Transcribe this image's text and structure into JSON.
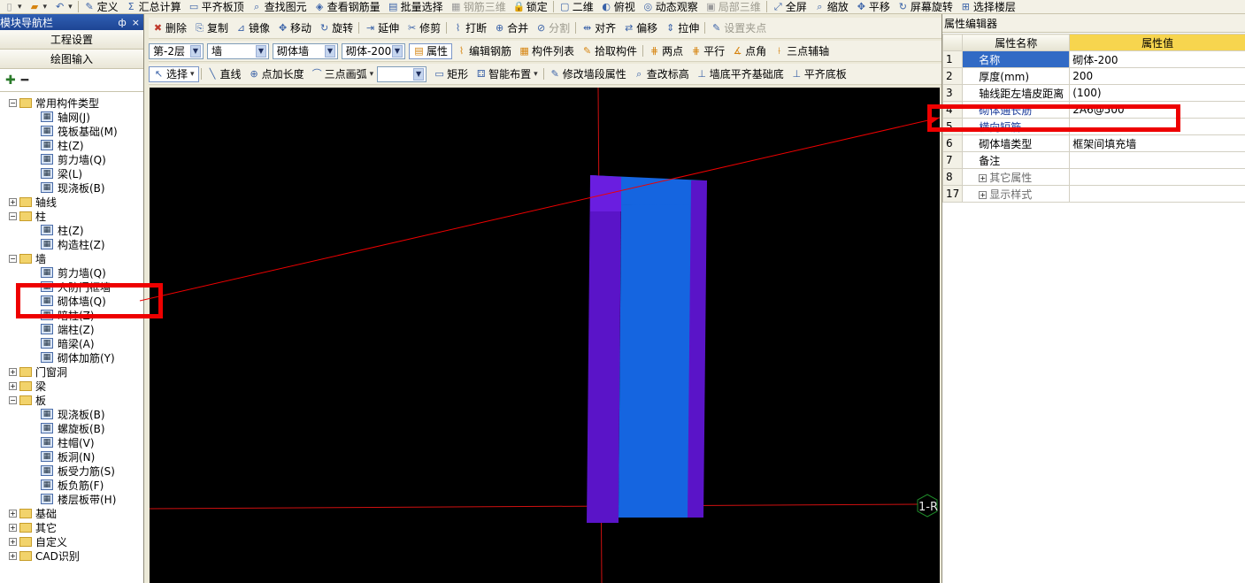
{
  "toolbar_top": {
    "items": [
      {
        "label": "定义",
        "icon": "define-icon",
        "enabled": true
      },
      {
        "label": "汇总计算",
        "icon": "sum-icon",
        "enabled": true
      },
      {
        "label": "平齐板顶",
        "icon": "align-top-icon",
        "enabled": true
      },
      {
        "label": "查找图元",
        "icon": "find-icon",
        "enabled": true
      },
      {
        "label": "查看钢筋量",
        "icon": "rebar-view-icon",
        "enabled": true
      },
      {
        "label": "批量选择",
        "icon": "batch-select-icon",
        "enabled": true
      },
      {
        "label": "钢筋三维",
        "icon": "rebar-3d-icon",
        "enabled": false
      },
      {
        "label": "锁定",
        "icon": "lock-icon",
        "enabled": true
      },
      {
        "label": "二维",
        "icon": "2d-icon",
        "enabled": true
      },
      {
        "label": "俯视",
        "icon": "top-view-icon",
        "enabled": true
      },
      {
        "label": "动态观察",
        "icon": "orbit-icon",
        "enabled": true
      },
      {
        "label": "局部三维",
        "icon": "local-3d-icon",
        "enabled": false
      },
      {
        "label": "全屏",
        "icon": "fullscreen-icon",
        "enabled": true
      },
      {
        "label": "缩放",
        "icon": "zoom-icon",
        "enabled": true
      },
      {
        "label": "平移",
        "icon": "pan-icon",
        "enabled": true
      },
      {
        "label": "屏幕旋转",
        "icon": "rotate-screen-icon",
        "enabled": true
      },
      {
        "label": "选择楼层",
        "icon": "floor-select-icon",
        "enabled": true
      }
    ]
  },
  "navigator": {
    "title": "模块导航栏",
    "pin_symbol": "ф",
    "close_symbol": "×",
    "buttons": [
      "工程设置",
      "绘图输入"
    ],
    "tree": [
      {
        "label": "常用构件类型",
        "level": 0,
        "folder": true,
        "expanded": true
      },
      {
        "label": "轴网(J)",
        "level": 1
      },
      {
        "label": "筏板基础(M)",
        "level": 1
      },
      {
        "label": "柱(Z)",
        "level": 1
      },
      {
        "label": "剪力墙(Q)",
        "level": 1
      },
      {
        "label": "梁(L)",
        "level": 1
      },
      {
        "label": "现浇板(B)",
        "level": 1
      },
      {
        "label": "轴线",
        "level": 0,
        "folder": true,
        "expanded": false
      },
      {
        "label": "柱",
        "level": 0,
        "folder": true,
        "expanded": true
      },
      {
        "label": "柱(Z)",
        "level": 1
      },
      {
        "label": "构造柱(Z)",
        "level": 1
      },
      {
        "label": "墙",
        "level": 0,
        "folder": true,
        "expanded": true
      },
      {
        "label": "剪力墙(Q)",
        "level": 1
      },
      {
        "label": "人防门框墙",
        "level": 1
      },
      {
        "label": "砌体墙(Q)",
        "level": 1
      },
      {
        "label": "暗柱(Z)",
        "level": 1
      },
      {
        "label": "端柱(Z)",
        "level": 1
      },
      {
        "label": "暗梁(A)",
        "level": 1
      },
      {
        "label": "砌体加筋(Y)",
        "level": 1
      },
      {
        "label": "门窗洞",
        "level": 0,
        "folder": true,
        "expanded": false
      },
      {
        "label": "梁",
        "level": 0,
        "folder": true,
        "expanded": false
      },
      {
        "label": "板",
        "level": 0,
        "folder": true,
        "expanded": true
      },
      {
        "label": "现浇板(B)",
        "level": 1
      },
      {
        "label": "螺旋板(B)",
        "level": 1
      },
      {
        "label": "柱帽(V)",
        "level": 1
      },
      {
        "label": "板洞(N)",
        "level": 1
      },
      {
        "label": "板受力筋(S)",
        "level": 1
      },
      {
        "label": "板负筋(F)",
        "level": 1
      },
      {
        "label": "楼层板带(H)",
        "level": 1
      },
      {
        "label": "基础",
        "level": 0,
        "folder": true,
        "expanded": false
      },
      {
        "label": "其它",
        "level": 0,
        "folder": true,
        "expanded": false
      },
      {
        "label": "自定义",
        "level": 0,
        "folder": true,
        "expanded": false
      },
      {
        "label": "CAD识别",
        "level": 0,
        "folder": true,
        "expanded": false
      }
    ]
  },
  "edit_toolbar": {
    "items": [
      "删除",
      "复制",
      "镜像",
      "移动",
      "旋转",
      "延伸",
      "修剪",
      "打断",
      "合并",
      "分割",
      "对齐",
      "偏移",
      "拉伸",
      "设置夹点"
    ]
  },
  "component_toolbar": {
    "floor": "第-2层",
    "type": "墙",
    "subtype": "砌体墙",
    "component": "砌体-200",
    "items": [
      "属性",
      "编辑钢筋",
      "构件列表",
      "拾取构件",
      "两点",
      "平行",
      "点角",
      "三点辅轴"
    ]
  },
  "draw_toolbar": {
    "select_label": "选择",
    "items": [
      "直线",
      "点加长度",
      "三点画弧",
      "矩形",
      "智能布置",
      "修改墙段属性",
      "查改标高",
      "墙底平齐基础底",
      "平齐底板"
    ]
  },
  "canvas": {
    "axis_label": "1-R",
    "colors": {
      "background": "#000000",
      "wall_purple": "#5a14c8",
      "wall_blue": "#1565e0",
      "axis_red": "#d01010"
    }
  },
  "properties": {
    "title": "属性编辑器",
    "col_name": "属性名称",
    "col_value": "属性值",
    "rows": [
      {
        "num": "1",
        "name": "名称",
        "value": "砌体-200",
        "selected": true
      },
      {
        "num": "2",
        "name": "厚度(mm)",
        "value": "200"
      },
      {
        "num": "3",
        "name": "轴线距左墙皮距离",
        "value": "(100)"
      },
      {
        "num": "4",
        "name": "砌体通长筋",
        "value": "2A6@500",
        "link": true
      },
      {
        "num": "5",
        "name": "横向短筋",
        "value": "",
        "link": true
      },
      {
        "num": "6",
        "name": "砌体墙类型",
        "value": "框架间填充墙"
      },
      {
        "num": "7",
        "name": "备注",
        "value": ""
      },
      {
        "num": "8",
        "name": "其它属性",
        "value": "",
        "group": true
      },
      {
        "num": "17",
        "name": "显示样式",
        "value": "",
        "group": true
      }
    ]
  }
}
